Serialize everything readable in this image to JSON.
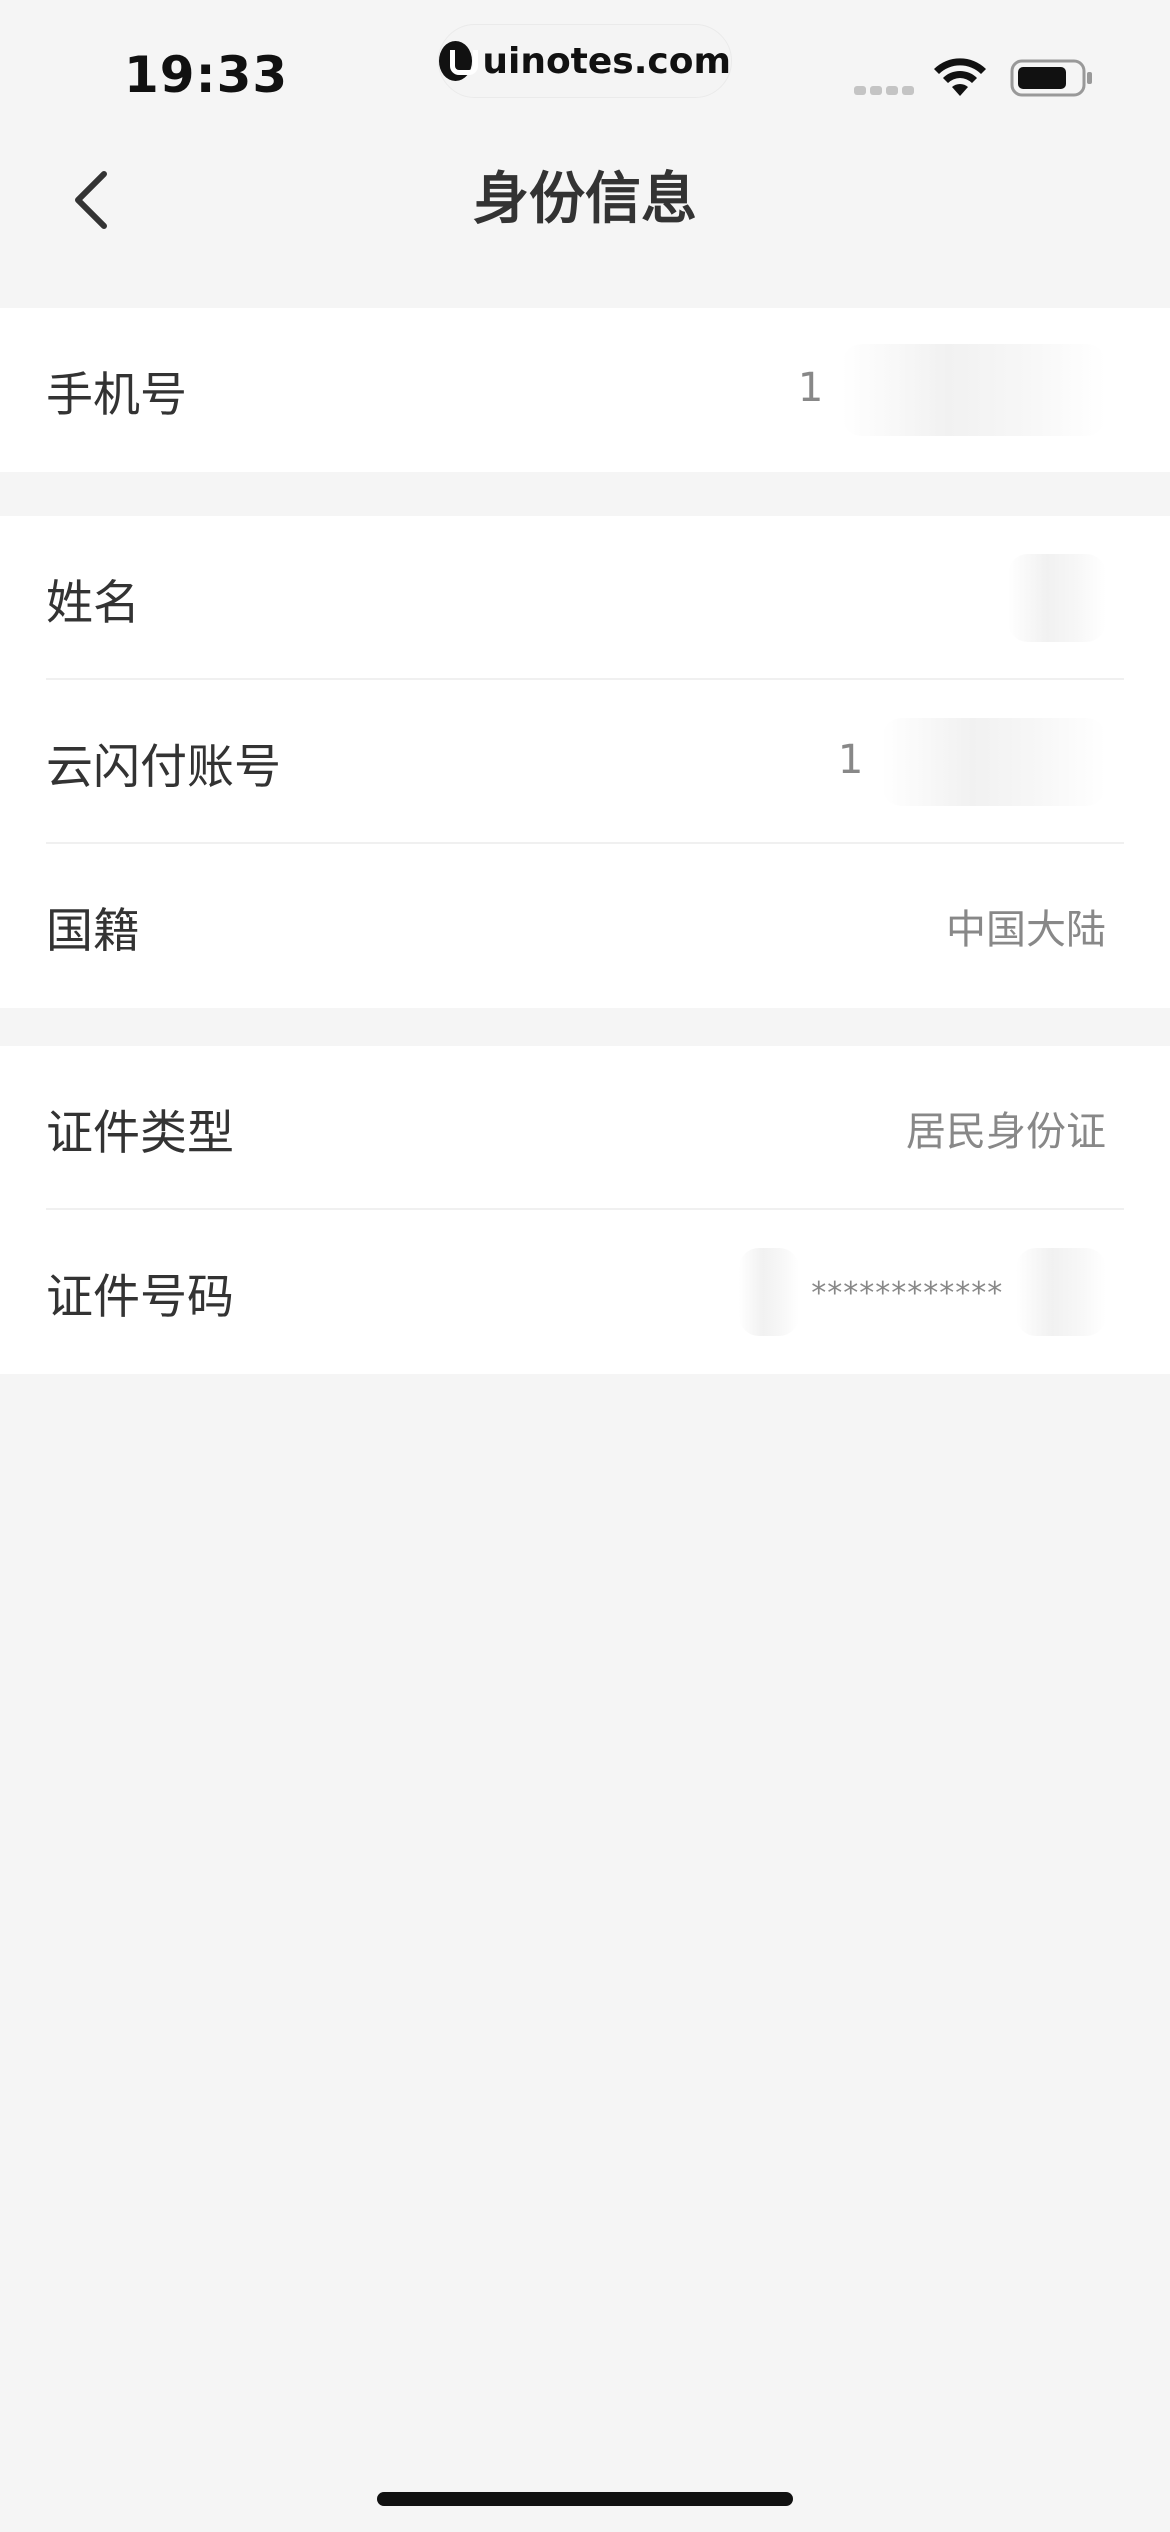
{
  "status_bar": {
    "time": "19:33",
    "watermark": "uinotes.com"
  },
  "nav": {
    "back_icon": "chevron-left-icon",
    "title": "身份信息"
  },
  "groups": [
    {
      "rows": [
        {
          "label": "手机号",
          "value": "1"
        }
      ]
    },
    {
      "rows": [
        {
          "label": "姓名",
          "value": ""
        },
        {
          "label": "云闪付账号",
          "value": "1"
        },
        {
          "label": "国籍",
          "value": "中国大陆"
        }
      ]
    },
    {
      "rows": [
        {
          "label": "证件类型",
          "value": "居民身份证"
        },
        {
          "label": "证件号码",
          "value": "************"
        }
      ]
    }
  ],
  "colors": {
    "background": "#f5f5f5",
    "card": "#ffffff",
    "text_primary": "#333333",
    "text_secondary": "#888888"
  }
}
